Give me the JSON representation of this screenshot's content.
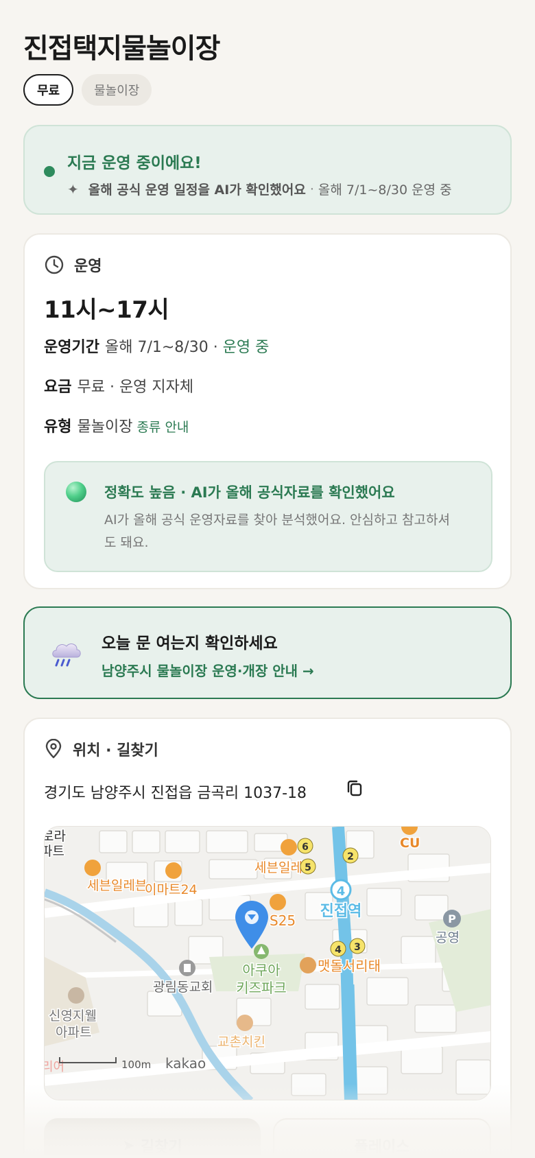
{
  "page": {
    "title": "진접택지물놀이장",
    "chips": [
      "무료",
      "물놀이장"
    ]
  },
  "status": {
    "title": "지금 운영 중이에요!",
    "ai_note": "올해 공식 운영 일정을 AI가 확인했어요",
    "separator": "·",
    "period_note": "올해 7/1~8/30 운영 중"
  },
  "operation": {
    "section_label": "운영",
    "hours": "11시~17시",
    "period_key": "운영기간",
    "period_value": "올해 7/1~8/30",
    "period_dot": "·",
    "period_status": "운영 중",
    "fee_key": "요금",
    "fee_value": "무료 · 운영 지자체",
    "type_key": "유형",
    "type_value": "물놀이장",
    "type_link": "종류 안내",
    "accuracy_title": "정확도 높음 · AI가 올해 공식자료를 확인했어요",
    "accuracy_desc": "AI가 올해 공식 운영자료를 찾아 분석했어요. 안심하고 참고하셔도 돼요."
  },
  "open_check": {
    "title": "오늘 문 여는지 확인하세요",
    "link": "남양주시 물놀이장 운영·개장 안내 →"
  },
  "location": {
    "section_label": "위치 · 길찾기",
    "address": "경기도 남양주시 진접읍 금곡리 1037-18"
  },
  "map": {
    "labels": {
      "seven1": "세븐일레븐",
      "emart": "이마트24",
      "seven2": "세븐일레븐",
      "cu": "CU",
      "s25": "S25",
      "station": "진접역",
      "station_no": "4",
      "aqua1": "아쿠아",
      "aqua2": "키즈파크",
      "church": "광림동교회",
      "restaurant": "맷돌서리태",
      "apt1": "신영지웰",
      "apt2": "아파트",
      "chicken": "교촌치킨",
      "parking": "P",
      "park": "공영",
      "topleft1": "로라",
      "topleft2": "파트",
      "bottomleft": "리어",
      "scale": "100m",
      "brand": "kakao",
      "exit2": "2",
      "exit3": "3",
      "exit4": "4",
      "exit5": "5",
      "exit6": "6"
    }
  },
  "actions": {
    "route": "길찾기",
    "place": "플레이스"
  },
  "colors": {
    "accent": "#2b7a52",
    "accent_bg": "#e8f1ec",
    "map_orange": "#e8892b",
    "subway": "#5bbbe6"
  }
}
